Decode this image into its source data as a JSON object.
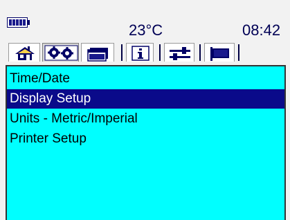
{
  "status_bar": {
    "temperature": "23°C",
    "time": "08:42",
    "battery_icon": "battery-full-icon"
  },
  "tabs": [
    {
      "icon": "home-icon",
      "active": false
    },
    {
      "icon": "gears-icon",
      "active": true
    },
    {
      "icon": "windows-icon",
      "active": false
    },
    {
      "icon": "info-icon",
      "active": false
    },
    {
      "icon": "sliders-icon",
      "active": false
    },
    {
      "icon": "flag-icon",
      "active": false
    }
  ],
  "menu": {
    "items": [
      {
        "label": "Time/Date",
        "selected": false
      },
      {
        "label": "Display Setup",
        "selected": true
      },
      {
        "label": "Units - Metric/Imperial",
        "selected": false
      },
      {
        "label": "Printer Setup",
        "selected": false
      }
    ]
  },
  "colors": {
    "menu_background": "#00ffff",
    "selection_background": "#0a0a8a",
    "selection_text": "#ffffff",
    "page_background": "#f2f2f2"
  }
}
